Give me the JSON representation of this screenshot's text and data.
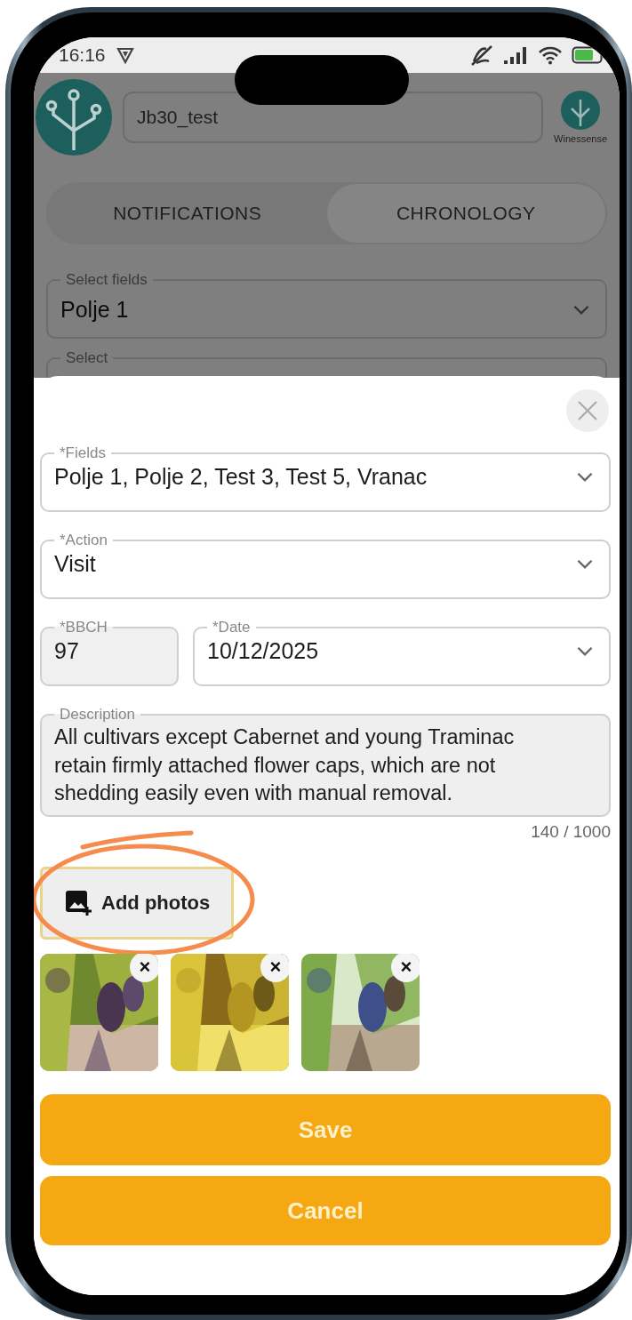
{
  "status_bar": {
    "time": "16:16"
  },
  "header": {
    "account": "Jb30_test",
    "brand": "Winessense"
  },
  "tabs": [
    {
      "label": "NOTIFICATIONS",
      "selected": false
    },
    {
      "label": "CHRONOLOGY",
      "selected": true
    }
  ],
  "filters": [
    {
      "label": "Select fields",
      "value": "Polje 1"
    },
    {
      "label": "Select"
    }
  ],
  "sheet": {
    "rows": [
      [
        {
          "kind": "select",
          "label": "*Fields",
          "value": "Polje 1, Polje 2, Test 3, Test 5, Vranac",
          "disabled": false
        }
      ],
      [
        {
          "kind": "select",
          "label": "*Action",
          "value": "Visit",
          "disabled": false
        }
      ],
      [
        {
          "kind": "text",
          "label": "*BBCH",
          "value": "97",
          "disabled": true
        },
        {
          "kind": "select",
          "label": "*Date",
          "value": "10/12/2025",
          "disabled": false
        }
      ],
      [
        {
          "kind": "textarea",
          "label": "Description",
          "value": "All cultivars except Cabernet and young Traminac retain firmly attached flower caps, which are not shedding easily even with manual removal."
        }
      ]
    ],
    "counter": "140 / 1000",
    "add_photos": "Add photos",
    "photos": [
      {
        "kind": "picture",
        "remove": "×"
      },
      {
        "kind": "picture",
        "remove": "×"
      },
      {
        "kind": "picture",
        "remove": "×"
      }
    ],
    "buttons": [
      "Save",
      "Cancel"
    ]
  }
}
